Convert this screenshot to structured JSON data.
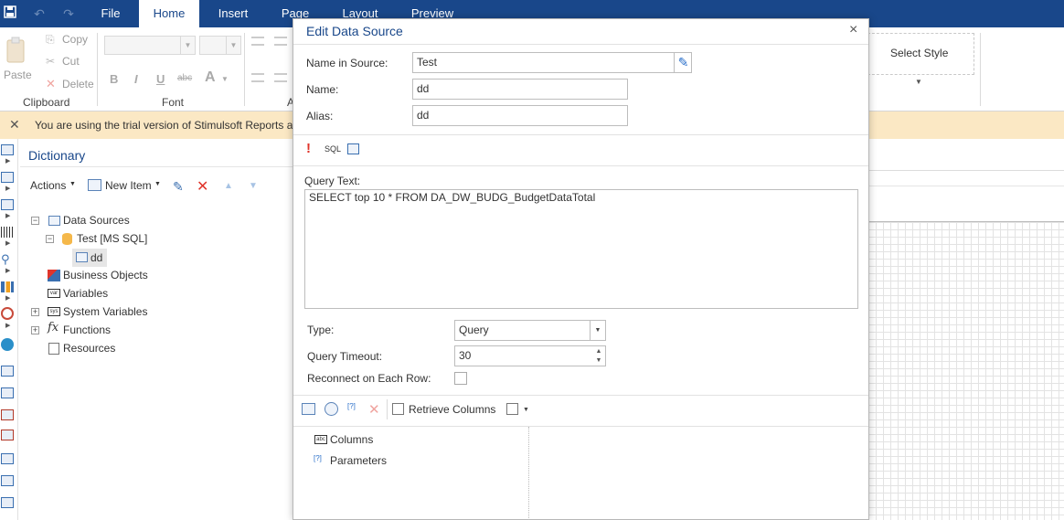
{
  "menu": {
    "tabs": [
      {
        "label": "File"
      },
      {
        "label": "Home"
      },
      {
        "label": "Insert"
      },
      {
        "label": "Page"
      },
      {
        "label": "Layout"
      },
      {
        "label": "Preview"
      }
    ]
  },
  "ribbon": {
    "clipboard": {
      "paste": "Paste",
      "copy": "Copy",
      "cut": "Cut",
      "delete": "Delete",
      "group": "Clipboard"
    },
    "font": {
      "group": "Font",
      "bold": "B",
      "italic": "I",
      "underline": "U",
      "strike": "abc",
      "color": "A"
    },
    "style": {
      "select_style": "Select Style"
    }
  },
  "notification": {
    "text": "You are using the trial version of Stimulsoft Reports a"
  },
  "dictionary": {
    "title": "Dictionary",
    "toolbar": {
      "actions": "Actions",
      "new_item": "New Item"
    },
    "tree": {
      "data_sources": "Data Sources",
      "connection": "Test [MS SQL]",
      "datasource": "dd",
      "business_objects": "Business Objects",
      "variables": "Variables",
      "system_variables": "System Variables",
      "functions": "Functions",
      "resources": "Resources"
    }
  },
  "dialog": {
    "title": "Edit Data Source",
    "name_in_source_label": "Name in Source:",
    "name_in_source_value": "Test",
    "name_label": "Name:",
    "name_value": "dd",
    "alias_label": "Alias:",
    "alias_value": "dd",
    "sql_label": "SQL",
    "query_text_label": "Query Text:",
    "query_text": "SELECT top 10 * FROM DA_DW_BUDG_BudgetDataTotal",
    "type_label": "Type:",
    "type_value": "Query",
    "timeout_label": "Query Timeout:",
    "timeout_value": "30",
    "reconnect_label": "Reconnect on Each Row:",
    "retrieve_columns": "Retrieve Columns",
    "tree": {
      "columns": "Columns",
      "parameters": "Parameters"
    }
  },
  "colors": {
    "brand": "#19478a",
    "notification_bg": "#fbe8c4",
    "delete_red": "#e0352b"
  }
}
